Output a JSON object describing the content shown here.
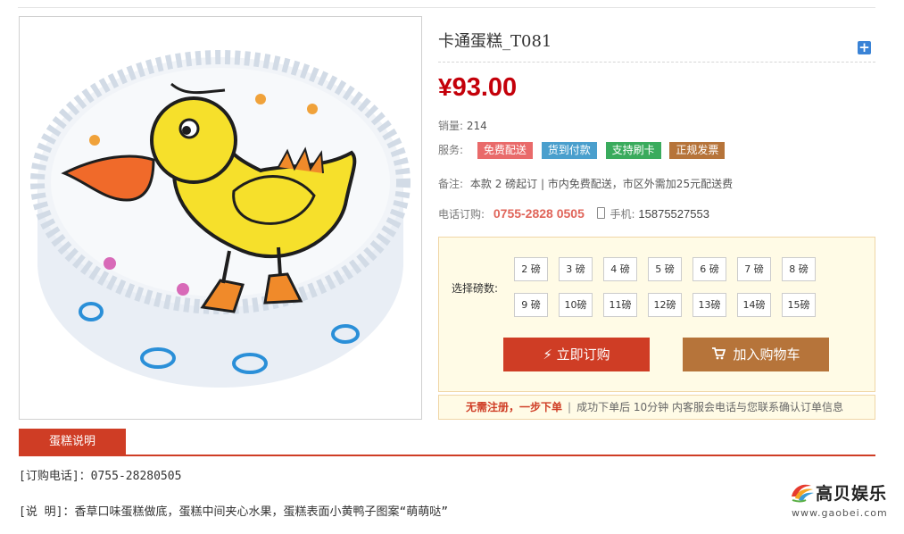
{
  "product": {
    "title": "卡通蛋糕_T081",
    "currency": "¥",
    "price": "93.00",
    "sales_label": "销量:",
    "sales_value": "214",
    "service_label": "服务:",
    "services": [
      {
        "label": "免费配送",
        "color": "#e96a6a"
      },
      {
        "label": "货到付款",
        "color": "#4a9fcd"
      },
      {
        "label": "支持刷卡",
        "color": "#3aab5d"
      },
      {
        "label": "正规发票",
        "color": "#b6743a"
      }
    ],
    "note_label": "备注:",
    "note_value": "本款 2 磅起订 | 市内免费配送，市区外需加25元配送费",
    "phone_label": "电话订购:",
    "phone_value": "0755-2828 0505",
    "mobile_label": "手机:",
    "mobile_value": "15875527553"
  },
  "selector": {
    "label": "选择磅数:",
    "sizes": [
      "2 磅",
      "3 磅",
      "4 磅",
      "5 磅",
      "6 磅",
      "7 磅",
      "8 磅",
      "9 磅",
      "10磅",
      "11磅",
      "12磅",
      "13磅",
      "14磅",
      "15磅"
    ],
    "buy_label": "立即订购",
    "cart_label": "加入购物车"
  },
  "tip": {
    "highlight": "无需注册，一步下单",
    "sep": "|",
    "text": "成功下单后 10分钟 内客服会电话与您联系确认订单信息"
  },
  "tab": {
    "label": "蛋糕说明"
  },
  "description": {
    "line1": "[订购电话]：0755-28280505",
    "line2": "[说 明]：香草口味蛋糕做底，蛋糕中间夹心水果，蛋糕表面小黄鸭子图案“萌萌哒”"
  },
  "watermark": {
    "title": "高贝娱乐",
    "url": "www.gaobei.com"
  },
  "colors": {
    "accent": "#cf3d25",
    "price": "#c4000a"
  },
  "icons": {
    "expand": "plus-icon",
    "buy": "lightning-icon",
    "cart": "cart-icon",
    "mobile": "mobile-phone-icon"
  }
}
